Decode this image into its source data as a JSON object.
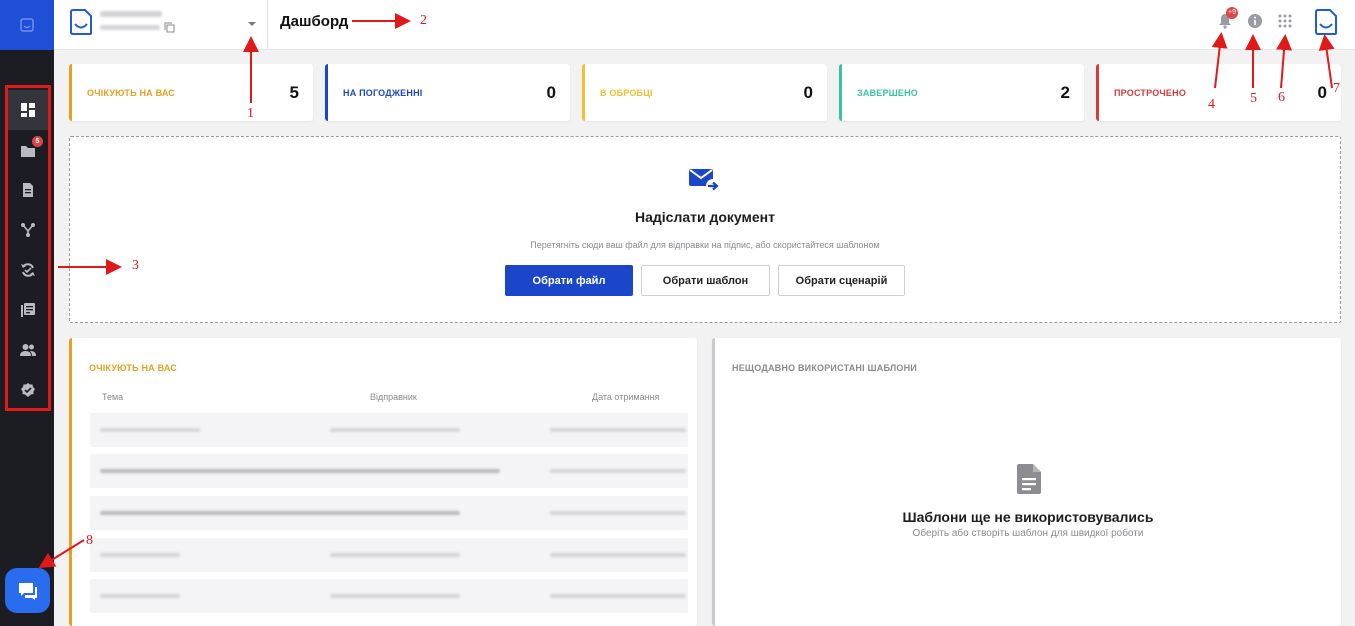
{
  "header": {
    "page_title": "Дашборд",
    "notification_badge": "+9"
  },
  "sidebar": {
    "badge_count": "5",
    "items": [
      {
        "name": "dashboard",
        "icon": "dashboard-icon"
      },
      {
        "name": "documents-folder",
        "icon": "folder-icon"
      },
      {
        "name": "document",
        "icon": "document-icon"
      },
      {
        "name": "scenarios",
        "icon": "branch-icon"
      },
      {
        "name": "sync",
        "icon": "sync-icon"
      },
      {
        "name": "templates",
        "icon": "templates-icon"
      },
      {
        "name": "contacts",
        "icon": "users-icon"
      },
      {
        "name": "verified",
        "icon": "verified-icon"
      }
    ]
  },
  "stats": [
    {
      "label": "ОЧІКУЮТЬ НА ВАС",
      "value": "5",
      "color": "#e8a020"
    },
    {
      "label": "НА ПОГОДЖЕННІ",
      "value": "0",
      "color": "#1c46c9"
    },
    {
      "label": "В ОБРОБЦІ",
      "value": "0",
      "color": "#f0c030"
    },
    {
      "label": "ЗАВЕРШЕНО",
      "value": "2",
      "color": "#36c4a4"
    },
    {
      "label": "ПРОСТРОЧЕНО",
      "value": "0",
      "color": "#d43c3c"
    }
  ],
  "upload": {
    "title": "Надіслати документ",
    "subtitle": "Перетягніть сюди ваш файл для відправки на підпис, або скористайтеся шаблоном",
    "choose_file": "Обрати файл",
    "choose_template": "Обрати шаблон",
    "choose_scenario": "Обрати сценарій"
  },
  "awaiting": {
    "title": "ОЧІКУЮТЬ НА ВАС",
    "columns": [
      "Тема",
      "Відправник",
      "Дата отримання"
    ]
  },
  "recent_templates": {
    "title": "НЕЩОДАВНО ВИКОРИСТАНІ ШАБЛОНИ",
    "empty_title": "Шаблони ще не використовувались",
    "empty_subtitle": "Оберіть або створіть шаблон для швидкої роботи"
  },
  "annotations": [
    "1",
    "2",
    "3",
    "4",
    "5",
    "6",
    "7",
    "8"
  ],
  "colors": {
    "accent": "#1c46c9",
    "annotation": "#e01919"
  }
}
